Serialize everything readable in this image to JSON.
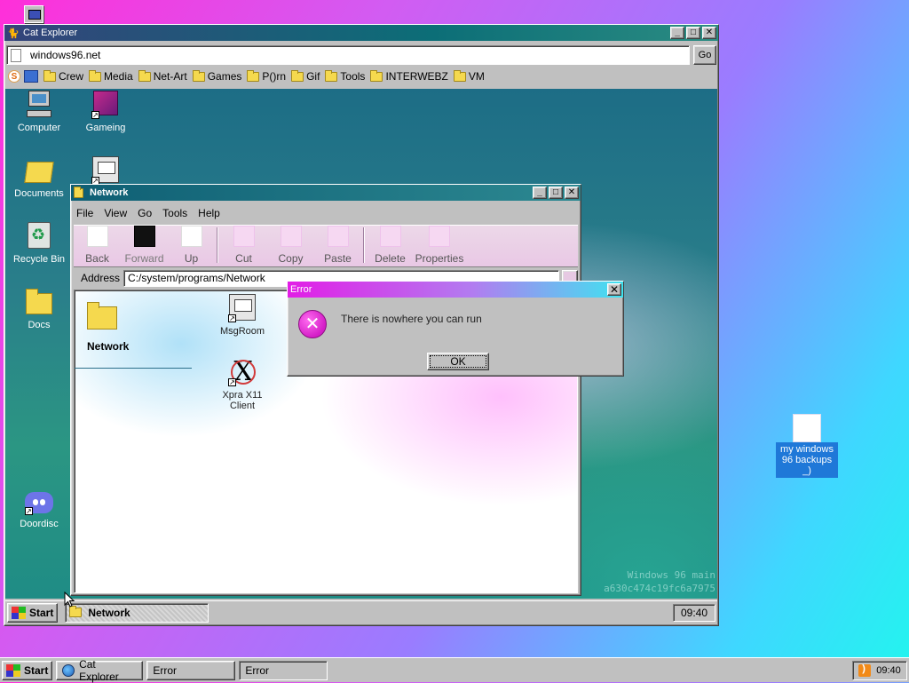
{
  "main_window": {
    "title": "Cat Explorer",
    "address": "windows96.net",
    "go_label": "Go",
    "bookmarks": [
      "Crew",
      "Media",
      "Net-Art",
      "Games",
      "P()rn",
      "Gif",
      "Tools",
      "INTERWEBZ",
      "VM"
    ]
  },
  "inner_desktop": {
    "icons": [
      "Computer",
      "Gameing",
      "Documents",
      "Recycle Bin",
      "Docs",
      "Doordisc"
    ],
    "watermark": [
      "Windows 96 main",
      "a630c474c19fc6a7975"
    ]
  },
  "network_window": {
    "title": "Network",
    "menu": [
      "File",
      "View",
      "Go",
      "Tools",
      "Help"
    ],
    "toolbar": [
      "Back",
      "Forward",
      "Up",
      "Cut",
      "Copy",
      "Paste",
      "Delete",
      "Properties"
    ],
    "address_label": "Address",
    "address": "C:/system/programs/Network",
    "sidebar_title": "Network",
    "items": [
      "MsgRoom",
      "Xpra X11 Client"
    ]
  },
  "error_dialog": {
    "title": "Error",
    "message": "There is nowhere you can run",
    "ok_label": "OK"
  },
  "outer_desktop": {
    "backups_label": "my windows 96 backups _)"
  },
  "inner_taskbar": {
    "start": "Start",
    "task": "Network",
    "clock": "09:40"
  },
  "outer_taskbar": {
    "start": "Start",
    "tasks": [
      "Cat Explorer",
      "Error",
      "Error"
    ],
    "clock": "09:40"
  },
  "colors": {
    "error_accent": "#d41ec7",
    "selection": "#1f78d8"
  }
}
